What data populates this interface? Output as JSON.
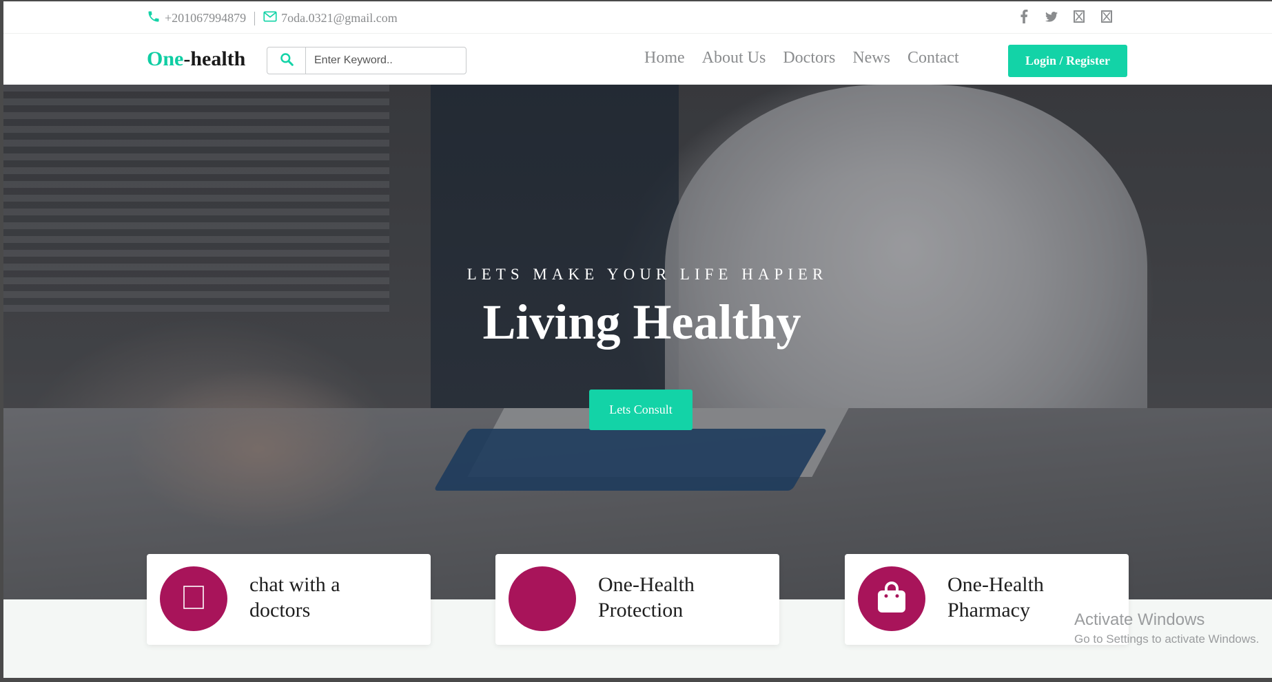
{
  "topbar": {
    "phone": "+201067994879",
    "email": "7oda.0321@gmail.com",
    "social": [
      "facebook-icon",
      "twitter-icon",
      "instagram-icon",
      "instagram-icon"
    ]
  },
  "nav": {
    "logo_accent": "One",
    "logo_rest": "-health",
    "search_placeholder": "Enter Keyword..",
    "menu": [
      "Home",
      "About Us",
      "Doctors",
      "News",
      "Contact"
    ],
    "login_label": "Login / Register"
  },
  "hero": {
    "tagline": "LETS MAKE YOUR LIFE HAPIER",
    "headline": "Living Healthy",
    "cta_label": "Lets Consult"
  },
  "cards": [
    {
      "label_line1": "chat with a",
      "label_line2": "doctors",
      "icon": "chat-icon"
    },
    {
      "label_line1": "One-Health",
      "label_line2": "Protection",
      "icon": "shield-icon"
    },
    {
      "label_line1": "One-Health",
      "label_line2": "Pharmacy",
      "icon": "bag-icon"
    }
  ],
  "watermark": {
    "line1": "Activate Windows",
    "line2": "Go to Settings to activate Windows."
  },
  "colors": {
    "accent": "#13d3a7",
    "card_icon_bg": "#a8145a",
    "muted_text": "#8a8c8e"
  }
}
